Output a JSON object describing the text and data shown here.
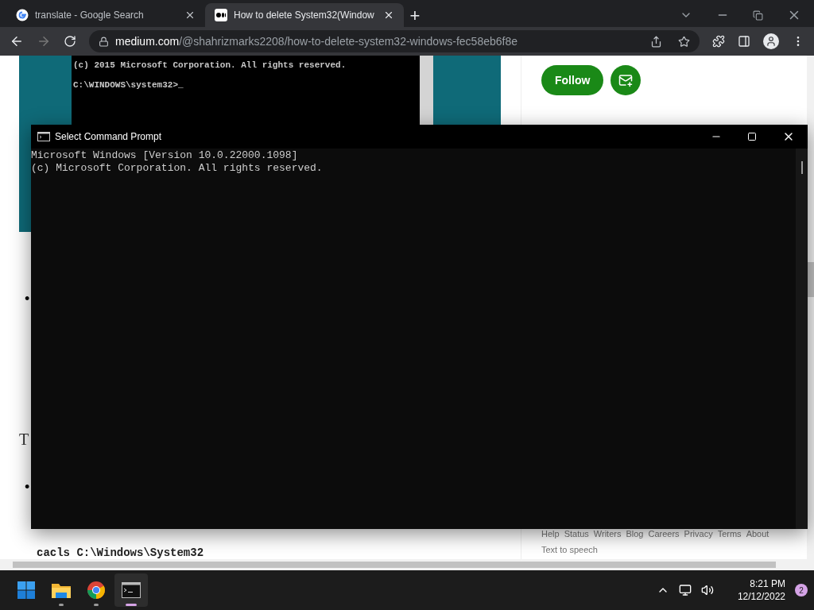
{
  "browser": {
    "tabs": [
      {
        "title": "translate - Google Search",
        "selected": false
      },
      {
        "title": "How to delete System32(Window",
        "selected": true
      }
    ],
    "new_tab": "+",
    "url_host": "medium.com",
    "url_path": "/@shahrizmarks2208/how-to-delete-system32-windows-fec58eb6f8e"
  },
  "article": {
    "image_lines": [
      "(c) 2015 Microsoft Corporation. All rights reserved.",
      "C:\\WINDOWS\\system32>_"
    ],
    "bullets": [
      "•",
      "•"
    ],
    "partial_heading": "T",
    "code_line": "cacls C:\\Windows\\System32"
  },
  "sidebar": {
    "follow": "Follow",
    "footer_links": [
      "Help",
      "Status",
      "Writers",
      "Blog",
      "Careers",
      "Privacy",
      "Terms",
      "About"
    ],
    "text_to_speech": "Text to speech"
  },
  "console": {
    "title": "Select Command Prompt",
    "lines": [
      "Microsoft Windows [Version 10.0.22000.1098]",
      "(c) Microsoft Corporation. All rights reserved."
    ]
  },
  "taskbar": {
    "apps": [
      {
        "kind": "start",
        "selected": false
      },
      {
        "kind": "files",
        "selected": false
      },
      {
        "kind": "chrome",
        "selected": false
      },
      {
        "kind": "terminal",
        "selected": true
      }
    ],
    "time": "8:21 PM",
    "date": "12/12/2022",
    "notifications": "2"
  }
}
